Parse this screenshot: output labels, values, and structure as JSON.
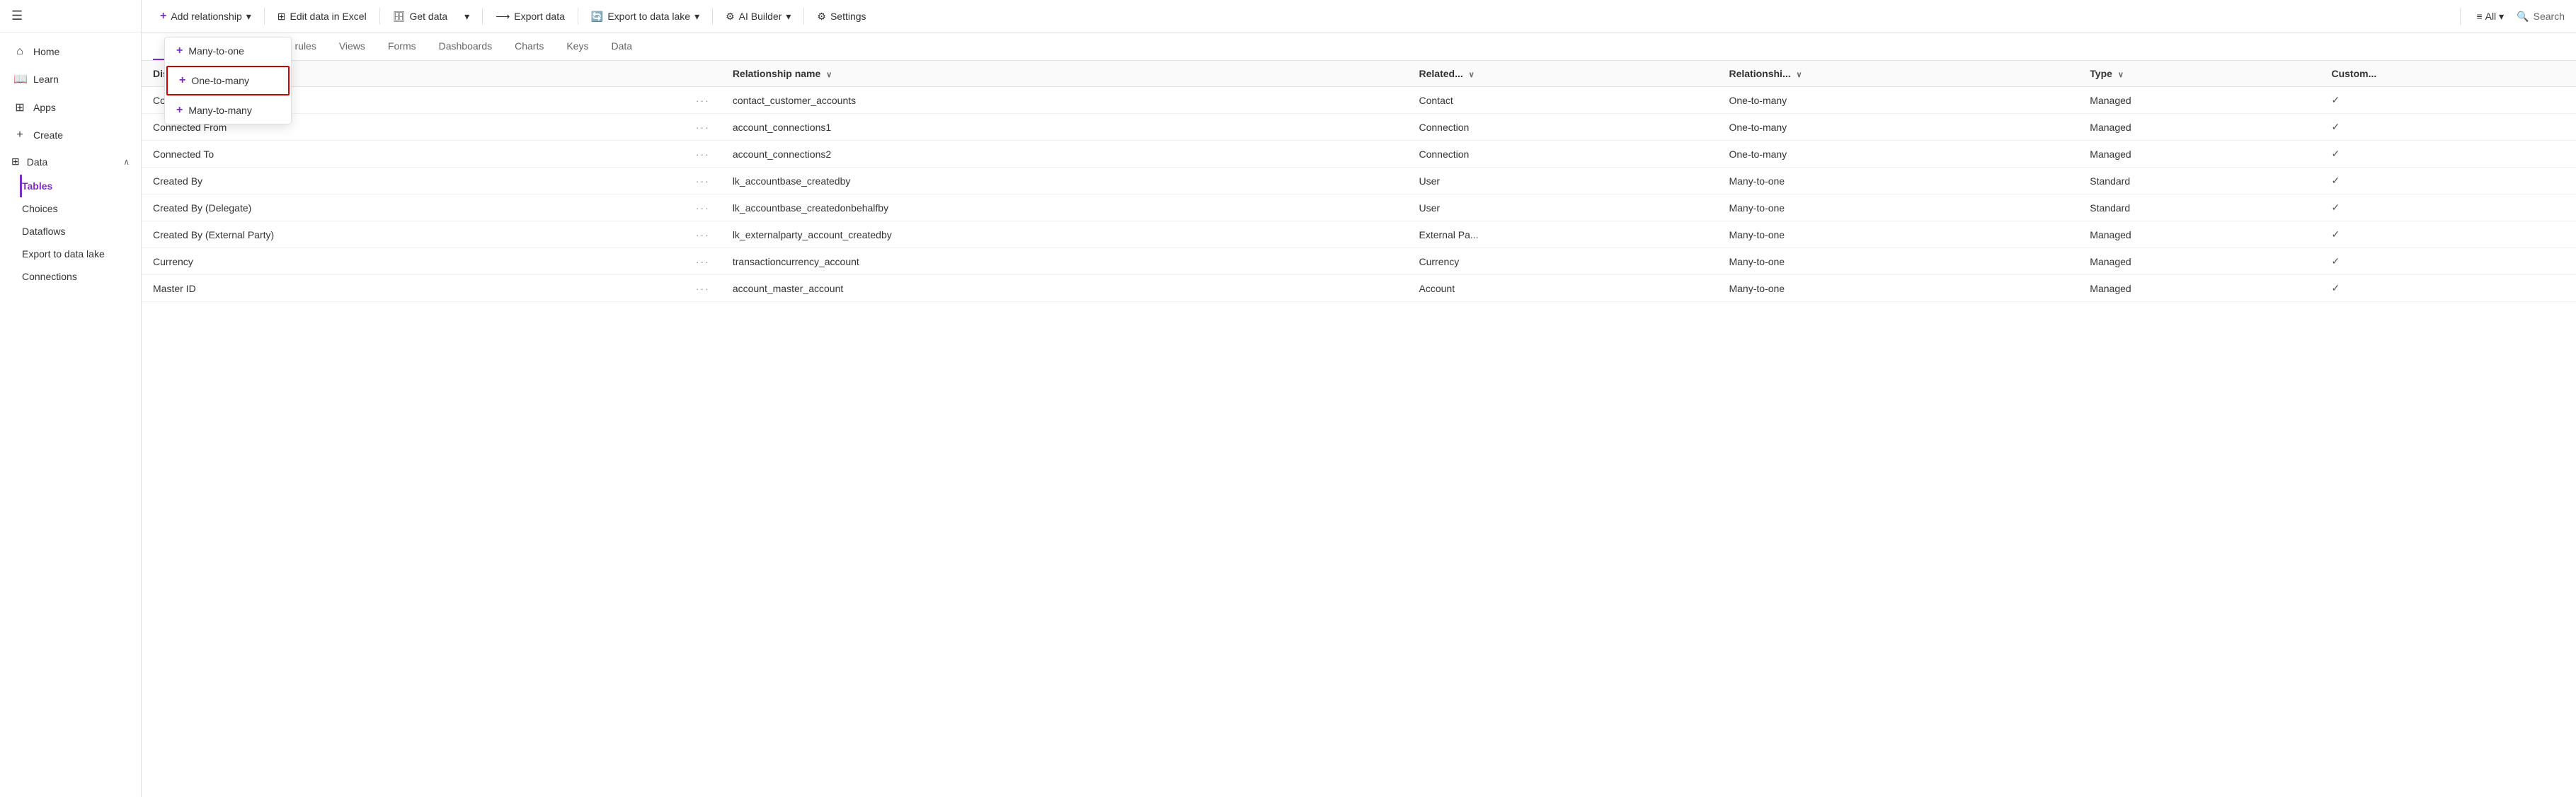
{
  "sidebar": {
    "hamburger": "☰",
    "items": [
      {
        "id": "home",
        "label": "Home",
        "icon": "⌂"
      },
      {
        "id": "learn",
        "label": "Learn",
        "icon": "📖"
      },
      {
        "id": "apps",
        "label": "Apps",
        "icon": "⊞"
      },
      {
        "id": "create",
        "label": "Create",
        "icon": "+"
      }
    ],
    "data_section": {
      "label": "Data",
      "icon": "⊞",
      "chevron": "∧",
      "sub_items": [
        {
          "id": "tables",
          "label": "Tables",
          "active": true
        },
        {
          "id": "choices",
          "label": "Choices"
        },
        {
          "id": "dataflows",
          "label": "Dataflows"
        },
        {
          "id": "export",
          "label": "Export to data lake"
        },
        {
          "id": "connections",
          "label": "Connections"
        }
      ]
    }
  },
  "toolbar": {
    "add_relationship_label": "Add relationship",
    "edit_excel_label": "Edit data in Excel",
    "get_data_label": "Get data",
    "export_data_label": "Export data",
    "export_lake_label": "Export to data lake",
    "ai_builder_label": "AI Builder",
    "settings_label": "Settings",
    "all_label": "All",
    "search_label": "Search",
    "dropdown_chevron": "▾"
  },
  "dropdown": {
    "items": [
      {
        "id": "many-to-one",
        "label": "Many-to-one",
        "highlighted": false
      },
      {
        "id": "one-to-many",
        "label": "One-to-many",
        "highlighted": true
      },
      {
        "id": "many-to-many",
        "label": "Many-to-many",
        "highlighted": false
      }
    ]
  },
  "tabs": [
    {
      "id": "relationships",
      "label": "Relationships",
      "active": true
    },
    {
      "id": "business-rules",
      "label": "Business rules"
    },
    {
      "id": "views",
      "label": "Views"
    },
    {
      "id": "forms",
      "label": "Forms"
    },
    {
      "id": "dashboards",
      "label": "Dashboards"
    },
    {
      "id": "charts",
      "label": "Charts"
    },
    {
      "id": "keys",
      "label": "Keys"
    },
    {
      "id": "data",
      "label": "Data"
    }
  ],
  "table": {
    "columns": [
      {
        "id": "display-name",
        "label": "Display name",
        "sortable": true
      },
      {
        "id": "dots",
        "label": ""
      },
      {
        "id": "relationship-name",
        "label": "Relationship name",
        "sortable": true
      },
      {
        "id": "related",
        "label": "Related...",
        "sortable": true
      },
      {
        "id": "relationship-type",
        "label": "Relationshi...",
        "sortable": true
      },
      {
        "id": "type",
        "label": "Type",
        "sortable": true
      },
      {
        "id": "custom",
        "label": "Custom..."
      }
    ],
    "rows": [
      {
        "display_name": "Company Name",
        "relationship_name": "contact_customer_accounts",
        "related": "Contact",
        "relationship_type": "One-to-many",
        "type": "Managed",
        "custom": true
      },
      {
        "display_name": "Connected From",
        "relationship_name": "account_connections1",
        "related": "Connection",
        "relationship_type": "One-to-many",
        "type": "Managed",
        "custom": true
      },
      {
        "display_name": "Connected To",
        "relationship_name": "account_connections2",
        "related": "Connection",
        "relationship_type": "One-to-many",
        "type": "Managed",
        "custom": true
      },
      {
        "display_name": "Created By",
        "relationship_name": "lk_accountbase_createdby",
        "related": "User",
        "relationship_type": "Many-to-one",
        "type": "Standard",
        "custom": true
      },
      {
        "display_name": "Created By (Delegate)",
        "relationship_name": "lk_accountbase_createdonbehalfby",
        "related": "User",
        "relationship_type": "Many-to-one",
        "type": "Standard",
        "custom": true
      },
      {
        "display_name": "Created By (External Party)",
        "relationship_name": "lk_externalparty_account_createdby",
        "related": "External Pa...",
        "relationship_type": "Many-to-one",
        "type": "Managed",
        "custom": true
      },
      {
        "display_name": "Currency",
        "relationship_name": "transactioncurrency_account",
        "related": "Currency",
        "relationship_type": "Many-to-one",
        "type": "Managed",
        "custom": true
      },
      {
        "display_name": "Master ID",
        "relationship_name": "account_master_account",
        "related": "Account",
        "relationship_type": "Many-to-one",
        "type": "Managed",
        "custom": true
      }
    ]
  }
}
